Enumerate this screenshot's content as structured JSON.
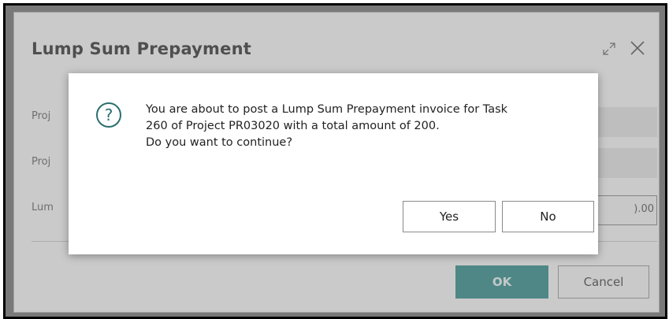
{
  "background_dialog": {
    "title": "Lump Sum Prepayment",
    "fields": [
      {
        "label": "Proj"
      },
      {
        "label": "Proj"
      },
      {
        "label": "Lum",
        "value": ").00"
      }
    ],
    "ok_label": "OK",
    "cancel_label": "Cancel",
    "icons": [
      "expand-icon",
      "close-icon"
    ]
  },
  "confirm_dialog": {
    "icon": "question-icon",
    "message_lines": [
      "You are about to post a Lump Sum Prepayment invoice for Task",
      "260 of Project PR03020 with a total amount of 200.",
      "Do you want to continue?"
    ],
    "yes_label": "Yes",
    "no_label": "No"
  },
  "colors": {
    "accent": "#3a8f8f",
    "icon": "#2a6f6f"
  }
}
